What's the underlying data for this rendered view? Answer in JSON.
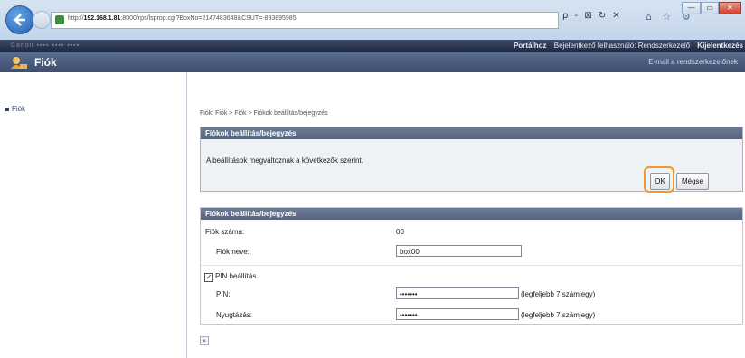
{
  "browser": {
    "url_prefix": "http://",
    "url_host": "192.168.1.81",
    "url_rest": ":8000/rps/lsprop.cgi?BoxNo=2147483648&CSUT=-893895985",
    "search_controls": "ρ - ⊠ ↻ ✕",
    "right_icons": "⌂ ☆ ⚙",
    "window_buttons": [
      "—",
      "▭",
      "✕"
    ]
  },
  "header": {
    "device_name": "Canon ▪▪▪▪ ▪▪▪▪ ▪▪▪▪",
    "links": [
      "Portálhoz",
      "Bejelentkező felhasználó: Rendszerkezelő",
      "Kijelentkezés"
    ],
    "title": "Fiók",
    "email_link": "E-mail a rendszerkezelőnek"
  },
  "sidebar": {
    "items": [
      {
        "label": "Fiók"
      }
    ]
  },
  "breadcrumb": "Fiók: Fiók > Fiók > Fiókok beállítás/bejegyzés",
  "panel1": {
    "title": "Fiókok beállítás/bejegyzés",
    "message": "A beállítások megváltoznak a következők szerint.",
    "ok_label": "OK",
    "cancel_label": "Mégse"
  },
  "panel2": {
    "title": "Fiókok beállítás/bejegyzés",
    "account_number_label": "Fiók száma:",
    "account_number_value": "00",
    "account_name_label": "Fiók neve:",
    "account_name_value": "box00",
    "pin_setting_label": "PIN beállítás",
    "pin_label": "PIN:",
    "pin_value": "•••••••",
    "pin_hint": "(legfeljebb 7 számjegy)",
    "confirm_label": "Nyugtázás:",
    "confirm_value": "•••••••",
    "confirm_hint": "(legfeljebb 7 számjegy)"
  },
  "colors": {
    "highlight": "#f39a1c",
    "header_dark": "#1d2740",
    "panel_head": "#55657f"
  }
}
